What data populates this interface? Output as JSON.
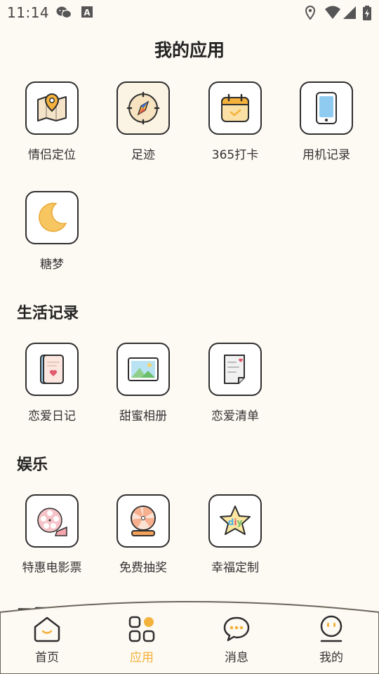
{
  "status_bar": {
    "time": "11:14",
    "left_icons": [
      "wechat-icon",
      "a-icon"
    ],
    "right_icons": [
      "location-icon",
      "wifi-icon",
      "signal-icon",
      "battery-charging-icon"
    ]
  },
  "page_title": "我的应用",
  "my_apps": [
    {
      "label": "情侣定位",
      "icon": "map-pin-icon"
    },
    {
      "label": "足迹",
      "icon": "compass-icon"
    },
    {
      "label": "365打卡",
      "icon": "calendar-check-icon"
    },
    {
      "label": "用机记录",
      "icon": "phone-icon"
    },
    {
      "label": "糖梦",
      "icon": "moon-icon"
    }
  ],
  "sections": [
    {
      "title": "生活记录",
      "apps": [
        {
          "label": "恋爱日记",
          "icon": "diary-icon"
        },
        {
          "label": "甜蜜相册",
          "icon": "photo-icon"
        },
        {
          "label": "恋爱清单",
          "icon": "list-icon"
        }
      ]
    },
    {
      "title": "娱乐",
      "apps": [
        {
          "label": "特惠电影票",
          "icon": "film-reel-icon"
        },
        {
          "label": "免费抽奖",
          "icon": "lottery-icon"
        },
        {
          "label": "幸福定制",
          "icon": "diy-star-icon"
        }
      ]
    }
  ],
  "partial_section_title": "工具",
  "bottom_nav": [
    {
      "label": "首页",
      "icon": "home-icon",
      "active": false
    },
    {
      "label": "应用",
      "icon": "apps-icon",
      "active": true
    },
    {
      "label": "消息",
      "icon": "message-icon",
      "active": false
    },
    {
      "label": "我的",
      "icon": "profile-icon",
      "active": false
    }
  ],
  "colors": {
    "background": "#fdf9f3",
    "accent": "#f3b23c",
    "icon_border": "#2f2f2f"
  }
}
